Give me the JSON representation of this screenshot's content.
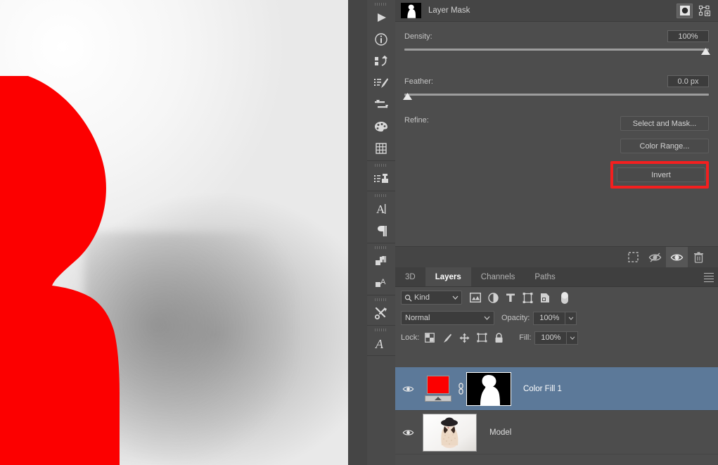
{
  "canvas": {
    "name": "document-canvas",
    "fill_color": "#fc0000",
    "background_desc": "light gray studio gradient"
  },
  "rail": {
    "groups": [
      {
        "items": [
          {
            "icon": "timeline-play-icon",
            "label": "Timeline"
          },
          {
            "icon": "info-icon",
            "label": "Info"
          },
          {
            "icon": "history-icon",
            "label": "History"
          },
          {
            "icon": "brush-presets-icon",
            "label": "Brush Presets"
          },
          {
            "icon": "adjustments-icon",
            "label": "Adjustments"
          },
          {
            "icon": "swatches-palette-icon",
            "label": "Swatches"
          },
          {
            "icon": "grid-icon",
            "label": "Patterns"
          }
        ]
      },
      {
        "items": [
          {
            "icon": "clone-source-icon",
            "label": "Clone Source"
          }
        ]
      },
      {
        "items": [
          {
            "icon": "character-icon",
            "label": "Character"
          },
          {
            "icon": "paragraph-icon",
            "label": "Paragraph"
          }
        ]
      },
      {
        "items": [
          {
            "icon": "paragraph-styles-icon",
            "label": "Paragraph Styles"
          },
          {
            "icon": "character-styles-icon",
            "label": "Character Styles"
          }
        ]
      },
      {
        "items": [
          {
            "icon": "tools-scissors-icon",
            "label": "Tool Presets"
          }
        ]
      },
      {
        "items": [
          {
            "icon": "glyphs-icon",
            "label": "Glyphs"
          }
        ]
      }
    ]
  },
  "properties": {
    "title": "Layer Mask",
    "pixel_mask_button": "pixel-mask",
    "vector_mask_button": "vector-mask",
    "density": {
      "label": "Density:",
      "value": "100%",
      "percent": 100
    },
    "feather": {
      "label": "Feather:",
      "value": "0.0 px",
      "percent": 0
    },
    "refine": {
      "label": "Refine:",
      "select_and_mask": "Select and Mask...",
      "color_range": "Color Range...",
      "invert": "Invert",
      "highlight_color": "#f41f1f"
    },
    "footer_buttons": [
      {
        "icon": "load-selection-icon",
        "label": "Load Selection From Mask",
        "active": false
      },
      {
        "icon": "apply-mask-icon",
        "label": "Apply Mask",
        "active": false
      },
      {
        "icon": "toggle-mask-visibility-icon",
        "label": "Disable/Enable Mask",
        "active": true
      },
      {
        "icon": "delete-mask-icon",
        "label": "Delete Mask",
        "active": false
      }
    ]
  },
  "layers_panel": {
    "tabs": [
      {
        "label": "3D",
        "active": false
      },
      {
        "label": "Layers",
        "active": true
      },
      {
        "label": "Channels",
        "active": false
      },
      {
        "label": "Paths",
        "active": false
      }
    ],
    "filter": {
      "kind_label": "Kind",
      "search_icon": "search-icon",
      "type_filters": [
        {
          "icon": "filter-pixel-layers-icon",
          "label": "Filter for pixel layers"
        },
        {
          "icon": "filter-adjustment-layers-icon",
          "label": "Filter for adjustment layers"
        },
        {
          "icon": "filter-type-layers-icon",
          "label": "Filter for type layers"
        },
        {
          "icon": "filter-shape-layers-icon",
          "label": "Filter for shape layers"
        },
        {
          "icon": "filter-smart-objects-icon",
          "label": "Filter for smart objects"
        }
      ],
      "toggle_label": "Turn layer filtering on/off"
    },
    "blend": {
      "mode": "Normal",
      "opacity_label": "Opacity:",
      "opacity_value": "100%"
    },
    "lock": {
      "label": "Lock:",
      "icons": [
        {
          "icon": "lock-transparent-pixels-icon",
          "label": "Lock transparent pixels"
        },
        {
          "icon": "lock-image-pixels-icon",
          "label": "Lock image pixels"
        },
        {
          "icon": "lock-position-icon",
          "label": "Lock position"
        },
        {
          "icon": "lock-artboard-nesting-icon",
          "label": "Prevent auto-nesting"
        },
        {
          "icon": "lock-all-icon",
          "label": "Lock all"
        }
      ],
      "fill_label": "Fill:",
      "fill_value": "100%"
    },
    "layers": [
      {
        "name": "Color Fill 1",
        "selected": true,
        "visible": true,
        "type": "fill-layer-with-mask",
        "fill_color": "#fc0000",
        "mask_selected": true,
        "linked": true
      },
      {
        "name": "Model",
        "selected": false,
        "visible": true,
        "type": "image-layer",
        "mask_selected": false,
        "linked": false
      }
    ]
  }
}
